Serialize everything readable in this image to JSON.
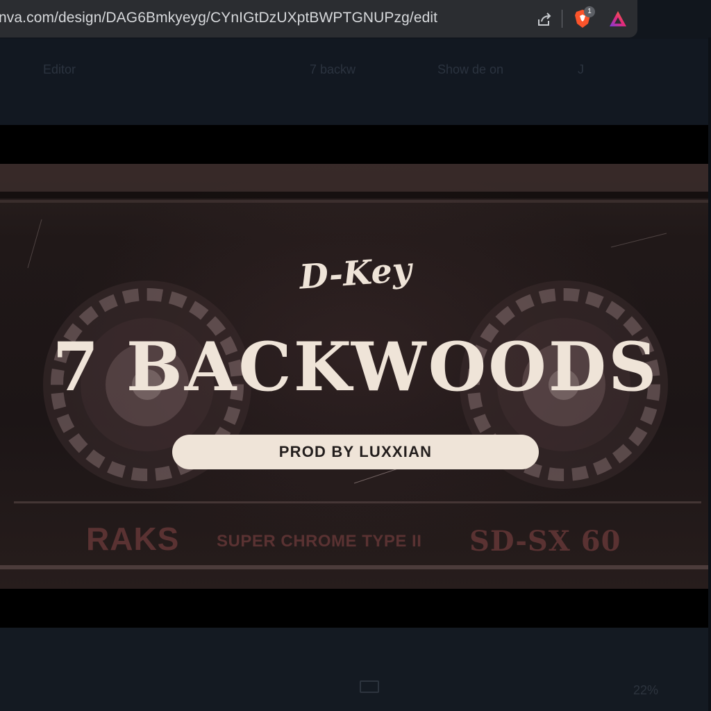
{
  "browser": {
    "url": "nva.com/design/DAG6Bmkyeyg/CYnIGtDzUXptBWPTGNUPzg/edit",
    "brave_badge": "1",
    "icons": [
      "share-icon",
      "brave-shield-icon",
      "brave-rewards-icon"
    ]
  },
  "editor_toolbar": {
    "items": [
      "Editor",
      "7 backw",
      "Show de on",
      "J"
    ]
  },
  "design": {
    "artist": "D-Key",
    "title": "7 BACKWOODS",
    "credit": "PROD BY LUXXIAN",
    "cassette_brand": "RAKS",
    "cassette_type": "SUPER CHROME TYPE II",
    "cassette_model": "SD-SX 60"
  },
  "status_bar": {
    "zoom": "22%"
  },
  "colors": {
    "text_cream": "#efe4d8",
    "pill_text": "#231e1d",
    "cassette_label": "#5a3232",
    "chrome_bg": "#2b2d31",
    "editor_bg": "#121821"
  }
}
